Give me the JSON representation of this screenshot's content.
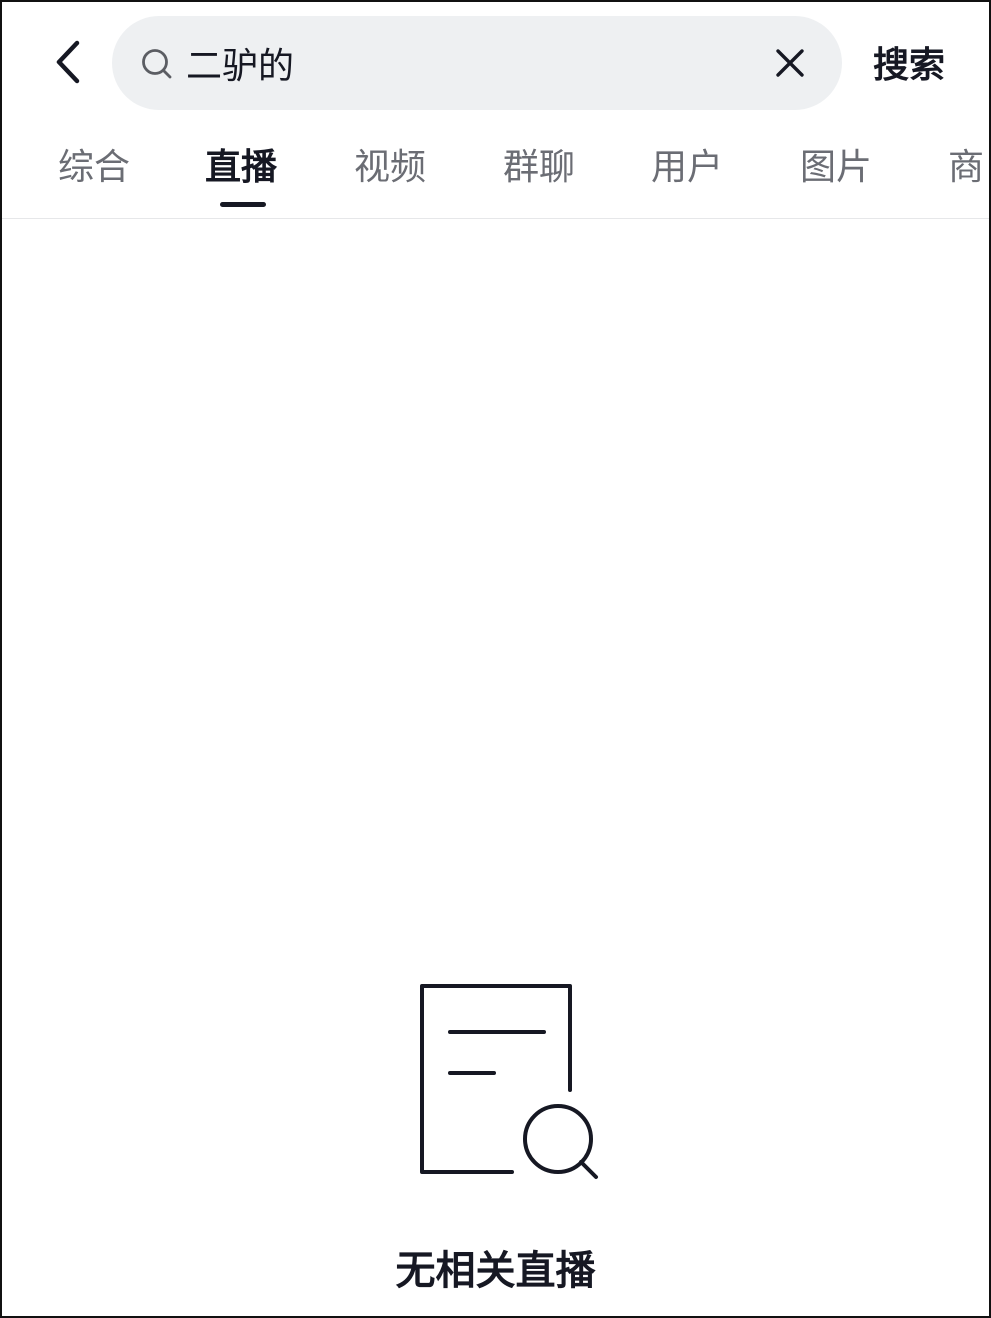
{
  "header": {
    "back_icon": "chevron-left-icon",
    "search": {
      "icon": "search-icon",
      "value": "二驴的",
      "placeholder": "",
      "clear_icon": "close-icon"
    },
    "submit_label": "搜索"
  },
  "tabs": {
    "active_index": 1,
    "items": [
      {
        "label": "综合"
      },
      {
        "label": "直播"
      },
      {
        "label": "视频"
      },
      {
        "label": "群聊"
      },
      {
        "label": "用户"
      },
      {
        "label": "图片"
      },
      {
        "label": "商"
      }
    ]
  },
  "empty_state": {
    "icon": "document-search-icon",
    "message": "无相关直播"
  },
  "colors": {
    "text_primary": "#161823",
    "text_secondary": "#6b6d74",
    "search_background": "#eef0f2",
    "divider": "#e6e7e9"
  }
}
